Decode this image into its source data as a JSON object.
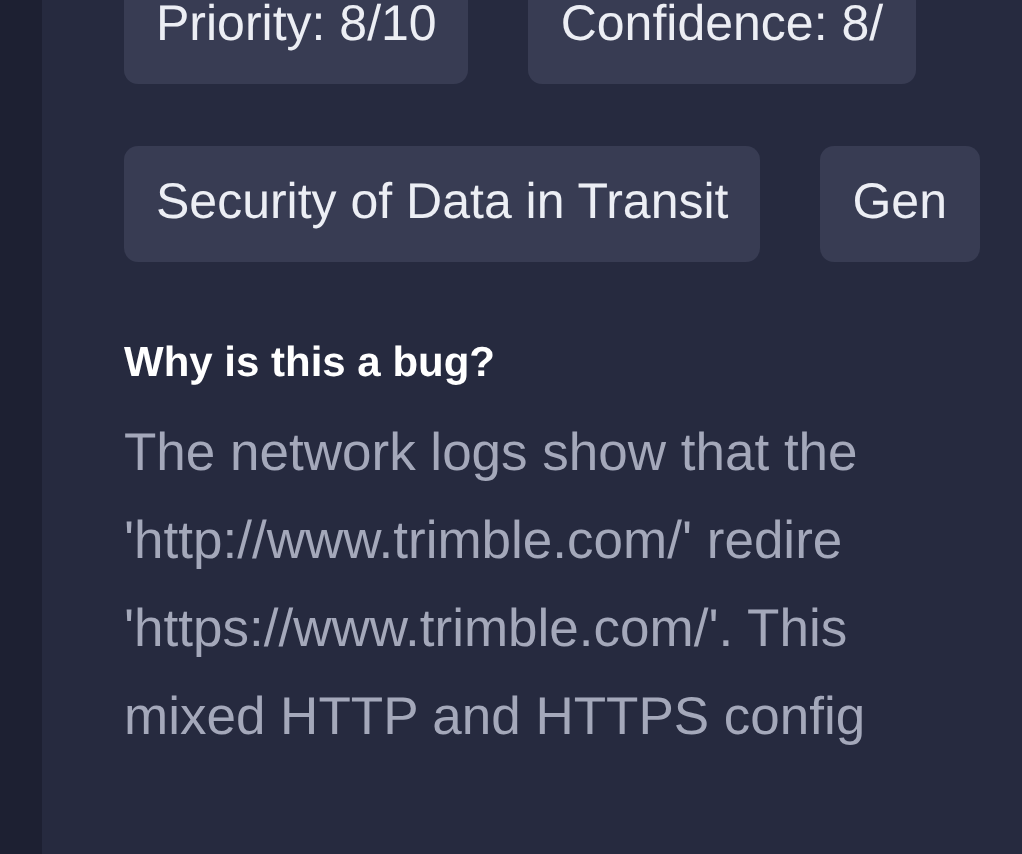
{
  "tag_rows": [
    [
      "Priority: 8/10",
      "Confidence: 8/"
    ],
    [
      "Security of Data in Transit",
      "Gen"
    ]
  ],
  "section": {
    "heading": "Why is this a bug?",
    "lines": [
      "The network logs show that the",
      "'http://www.trimble.com/' redire",
      "'https://www.trimble.com/'. This",
      "mixed HTTP and HTTPS config"
    ]
  }
}
